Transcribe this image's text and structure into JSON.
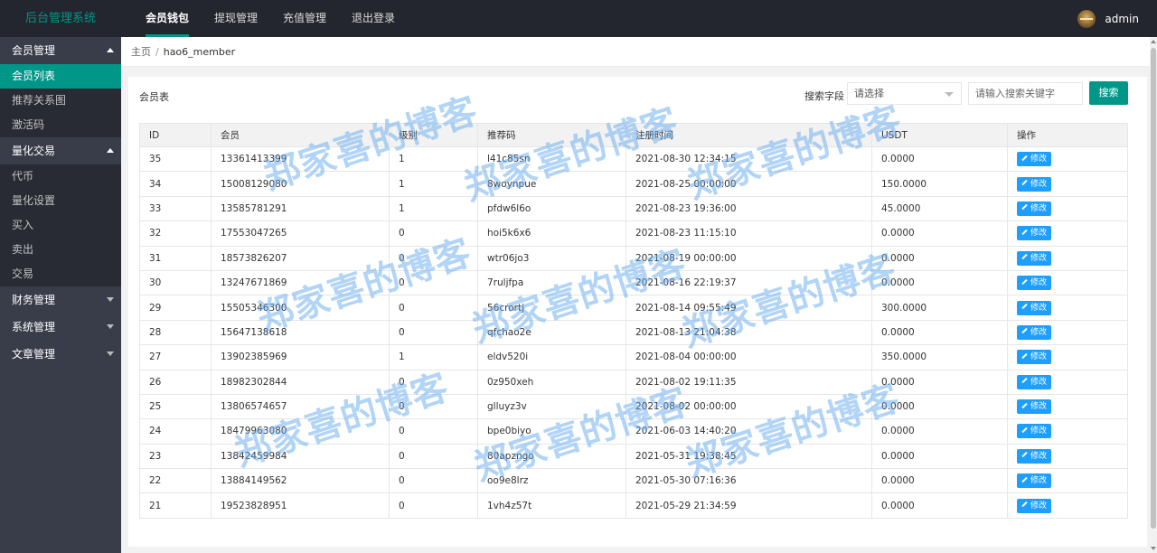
{
  "app": {
    "brand": "后台管理系统"
  },
  "topnav": [
    {
      "label": "会员钱包",
      "active": true
    },
    {
      "label": "提现管理"
    },
    {
      "label": "充值管理"
    },
    {
      "label": "退出登录"
    }
  ],
  "user": {
    "name": "admin"
  },
  "sidebar": {
    "group_member": "会员管理",
    "member_items": [
      "会员列表",
      "推荐关系图",
      "激活码"
    ],
    "group_quant": "量化交易",
    "quant_items": [
      "代币",
      "量化设置",
      "买入",
      "卖出",
      "交易"
    ],
    "group_finance": "财务管理",
    "group_system": "系统管理",
    "group_article": "文章管理"
  },
  "breadcrumb": {
    "home": "主页",
    "sep": "/",
    "current": "hao6_member"
  },
  "card": {
    "title": "会员表",
    "search_label": "搜索字段",
    "select_value": "请选择",
    "keyword_placeholder": "请输入搜索关键字",
    "search_button": "搜索"
  },
  "table": {
    "columns": [
      "ID",
      "会员",
      "级别",
      "推荐码",
      "注册时间",
      "USDT",
      "操作"
    ],
    "edit_label": "修改",
    "rows": [
      [
        "35",
        "13361413399",
        "1",
        "l41c85sn",
        "2021-08-30 12:34:15",
        "0.0000"
      ],
      [
        "34",
        "15008129080",
        "1",
        "8woynpue",
        "2021-08-25 00:00:00",
        "150.0000"
      ],
      [
        "33",
        "13585781291",
        "1",
        "pfdw6l6o",
        "2021-08-23 19:36:00",
        "45.0000"
      ],
      [
        "32",
        "17553047265",
        "0",
        "hoi5k6x6",
        "2021-08-23 11:15:10",
        "0.0000"
      ],
      [
        "31",
        "18573826207",
        "0",
        "wtr06jo3",
        "2021-08-19 00:00:00",
        "0.0000"
      ],
      [
        "30",
        "13247671869",
        "0",
        "7ruljfpa",
        "2021-08-16 22:19:37",
        "0.0000"
      ],
      [
        "29",
        "15505346300",
        "0",
        "56crortj",
        "2021-08-14 09:55:49",
        "300.0000"
      ],
      [
        "28",
        "15647138618",
        "0",
        "qfchao2e",
        "2021-08-13 21:04:38",
        "0.0000"
      ],
      [
        "27",
        "13902385969",
        "1",
        "eldv520i",
        "2021-08-04 00:00:00",
        "350.0000"
      ],
      [
        "26",
        "18982302844",
        "0",
        "0z950xeh",
        "2021-08-02 19:11:35",
        "0.0000"
      ],
      [
        "25",
        "13806574657",
        "0",
        "glluyz3v",
        "2021-08-02 00:00:00",
        "0.0000"
      ],
      [
        "24",
        "18479963080",
        "0",
        "bpe0biyo",
        "2021-06-03 14:40:20",
        "0.0000"
      ],
      [
        "23",
        "13842459984",
        "0",
        "80apzngo",
        "2021-05-31 19:38:45",
        "0.0000"
      ],
      [
        "22",
        "13884149562",
        "0",
        "oo9e8lrz",
        "2021-05-30 07:16:36",
        "0.0000"
      ],
      [
        "21",
        "19523828951",
        "0",
        "1vh4z57t",
        "2021-05-29 21:34:59",
        "0.0000"
      ]
    ]
  },
  "watermark": "郑家喜的博客",
  "colors": {
    "accent": "#009688",
    "edit_button": "#1e9fff",
    "topbar": "#23262e",
    "sidebar": "#393d49"
  }
}
